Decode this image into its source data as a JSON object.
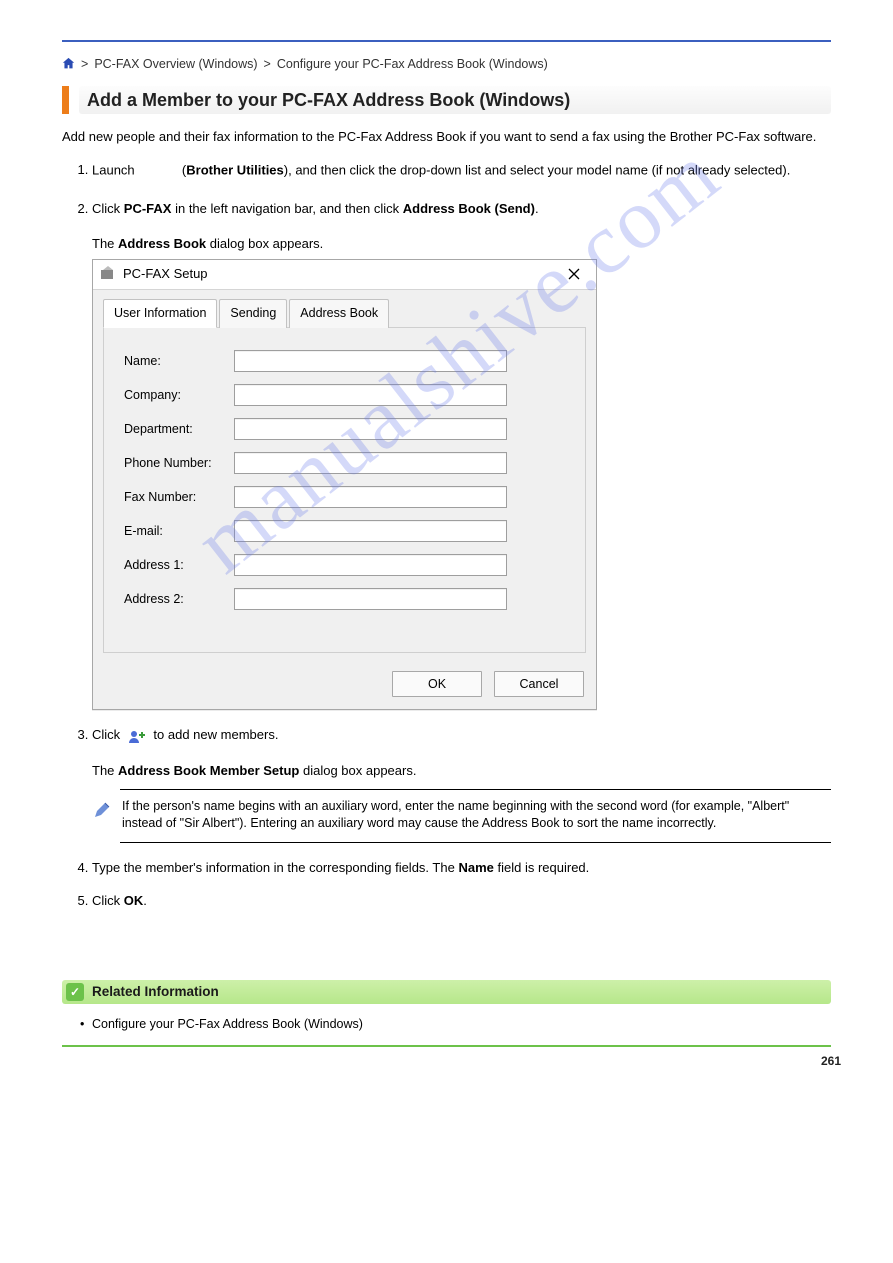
{
  "breadcrumb": {
    "home_link": "Home",
    "sep": ">",
    "level1": "PC-FAX Overview (Windows)",
    "level2": "Configure your PC-Fax Address Book (Windows)",
    "level3": ">"
  },
  "section": {
    "title": "Add a Member to your PC-FAX Address Book (Windows)",
    "intro": "Add new people and their fax information to the PC-Fax Address Book if you want to send a fax using the Brother PC-Fax software."
  },
  "steps": {
    "s1_a": "Launch",
    "s1_b": "(",
    "s1_c": "Brother Utilities",
    "s1_d": "), and then click the drop-down list and select your model name (if not already selected).",
    "s2_a": "Click",
    "s2_b": "PC-FAX",
    "s2_c": "in the left navigation bar, and then click",
    "s2_d": "Address Book (Send)",
    "s2_e": ".",
    "s2_f": "The",
    "s2_g": "Address Book",
    "s2_h": "dialog box appears.",
    "s3_a": "Click",
    "s3_b": "to add new members.",
    "s3_c": "The",
    "s3_d": "Address Book Member Setup",
    "s3_e": "dialog box appears.",
    "s4": "Type the member's information in the corresponding fields. The",
    "s4_b": "Name",
    "s4_c": "field is required.",
    "s5_a": "Click",
    "s5_b": "OK",
    "s5_c": "."
  },
  "dialog": {
    "title": "PC-FAX Setup",
    "tabs": {
      "t1": "User Information",
      "t2": "Sending",
      "t3": "Address Book"
    },
    "labels": {
      "name": "Name:",
      "company": "Company:",
      "department": "Department:",
      "phone": "Phone Number:",
      "fax": "Fax Number:",
      "email": "E-mail:",
      "addr1": "Address 1:",
      "addr2": "Address 2:"
    },
    "values": {
      "name": "",
      "company": "",
      "department": "",
      "phone": "",
      "fax": "",
      "email": "",
      "addr1": "",
      "addr2": ""
    },
    "ok": "OK",
    "cancel": "Cancel"
  },
  "note": {
    "text": "If the person's name begins with an auxiliary word, enter the name beginning with the second word (for example, \"Albert\" instead of \"Sir Albert\"). Entering an auxiliary word may cause the Address Book to sort the name incorrectly."
  },
  "related": {
    "heading": "Related Information",
    "link": "Configure your PC-Fax Address Book (Windows)"
  },
  "page_number": "261",
  "watermark": "manualshive.com"
}
